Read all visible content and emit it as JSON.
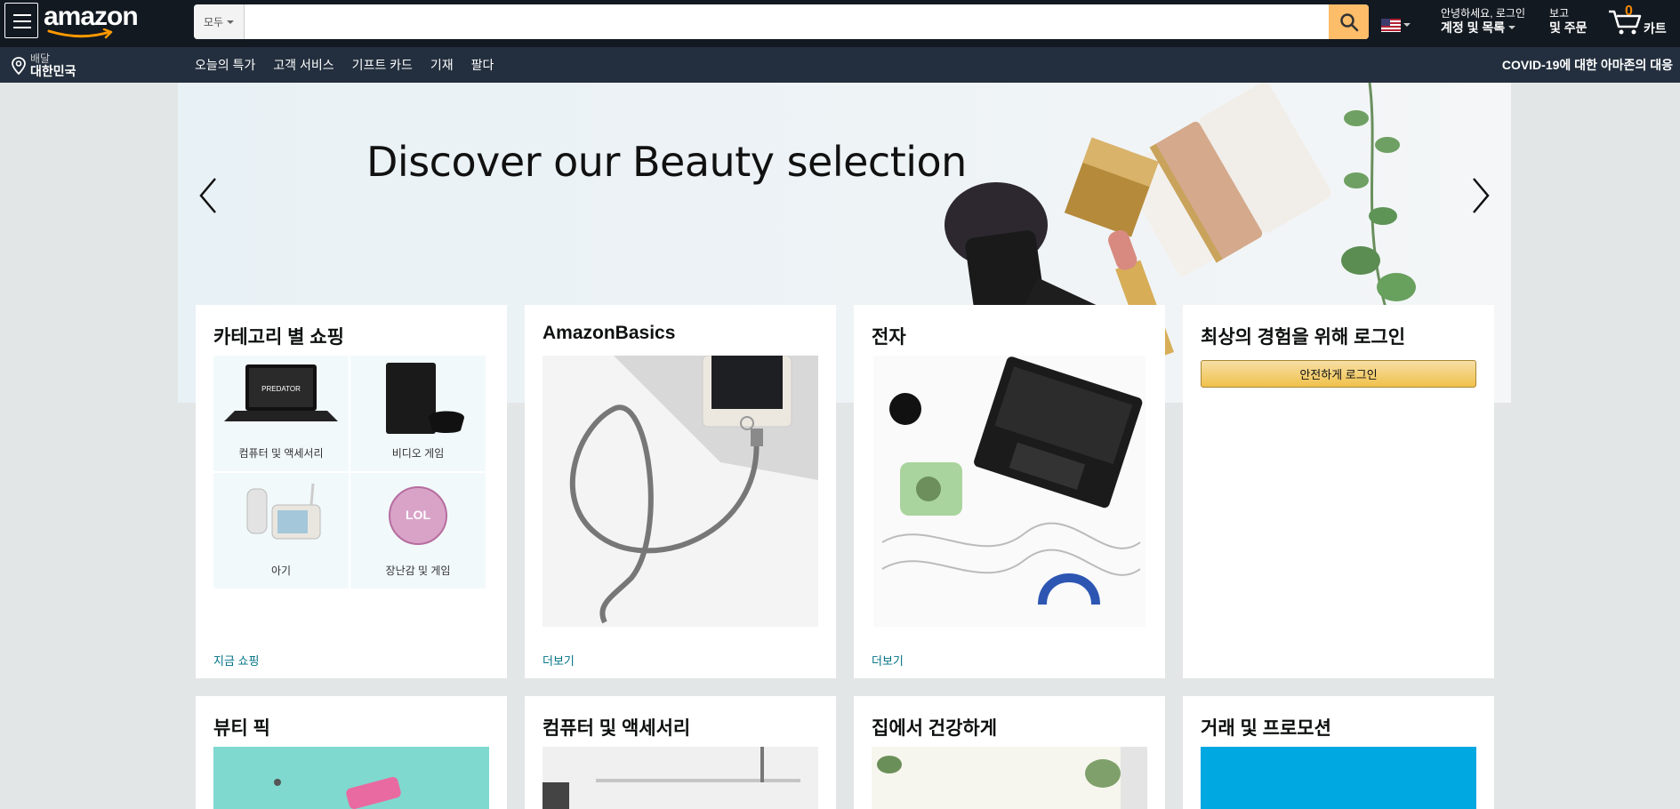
{
  "header": {
    "logo_text": "amazon",
    "search": {
      "category": "모두",
      "placeholder": "",
      "value": ""
    },
    "account": {
      "greeting": "안녕하세요, 로그인",
      "label": "계정 및 목록"
    },
    "orders": {
      "line1": "보고",
      "line2": "및 주문"
    },
    "cart": {
      "count": "0",
      "label": "카트"
    }
  },
  "subnav": {
    "deliver_line1": "배달",
    "deliver_line2": "대한민국",
    "links": [
      "오늘의 특가",
      "고객 서비스",
      "기프트 카드",
      "기재",
      "팔다"
    ],
    "covid": "COVID-19에 대한 아마존의 대응"
  },
  "hero": {
    "title": "Discover our Beauty selection"
  },
  "cards_row1": [
    {
      "title": "카테고리 별 쇼핑",
      "link": "지금 쇼핑",
      "items": [
        "컴퓨터 및 액세서리",
        "비디오 게임",
        "아기",
        "장난감 및 게임"
      ]
    },
    {
      "title": "AmazonBasics",
      "link": "더보기"
    },
    {
      "title": "전자",
      "link": "더보기"
    },
    {
      "title": "최상의 경험을 위해 로그인",
      "button": "안전하게 로그인"
    }
  ],
  "cards_row2": [
    {
      "title": "뷰티 픽"
    },
    {
      "title": "컴퓨터 및 액세서리"
    },
    {
      "title": "집에서 건강하게"
    },
    {
      "title": "거래 및 프로모션"
    }
  ],
  "colors": {
    "nav_top": "#131921",
    "nav_sub": "#232f3e",
    "search_button": "#febd69",
    "link": "#007185",
    "cart_count": "#f08804"
  }
}
